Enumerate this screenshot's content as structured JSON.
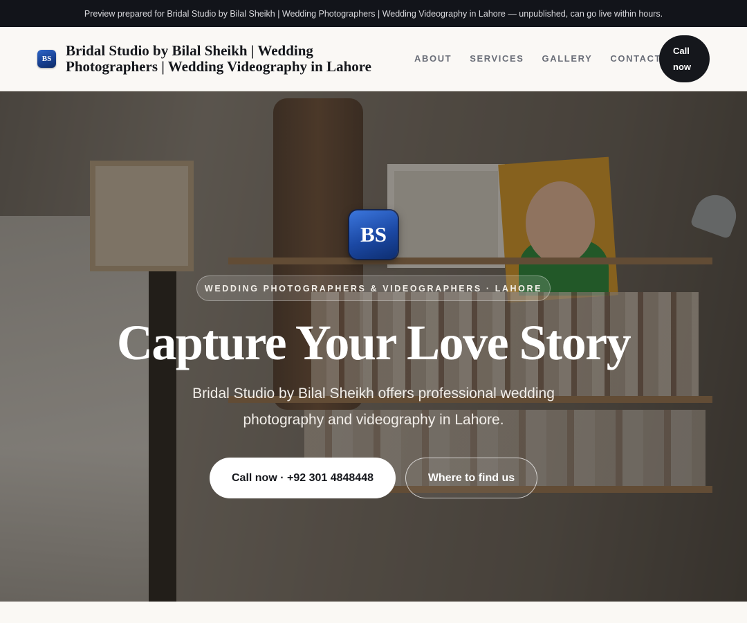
{
  "topbar": {
    "notice": "Preview prepared for Bridal Studio by Bilal Sheikh | Wedding Photographers | Wedding Videography in Lahore — unpublished, can go live within hours."
  },
  "header": {
    "logo_initials": "BS",
    "brand_title": "Bridal Studio by Bilal Sheikh | Wedding Photographers | Wedding Videography in Lahore",
    "nav": [
      "About",
      "Services",
      "Gallery",
      "Contact"
    ],
    "call_button": "Call now"
  },
  "hero": {
    "logo_initials": "BS",
    "eyebrow": "WEDDING PHOTOGRAPHERS & VIDEOGRAPHERS · LAHORE",
    "headline": "Capture Your Love Story",
    "subhead": "Bridal Studio by Bilal Sheikh offers professional wedding photography and videography in Lahore.",
    "primary_cta": "Call now · +92 301 4848448",
    "secondary_cta": "Where to find us"
  },
  "colors": {
    "topbar_bg": "#12141a",
    "header_bg": "#faf8f5",
    "brand_blue": "#1b48a3",
    "dark_button": "#15171c"
  }
}
